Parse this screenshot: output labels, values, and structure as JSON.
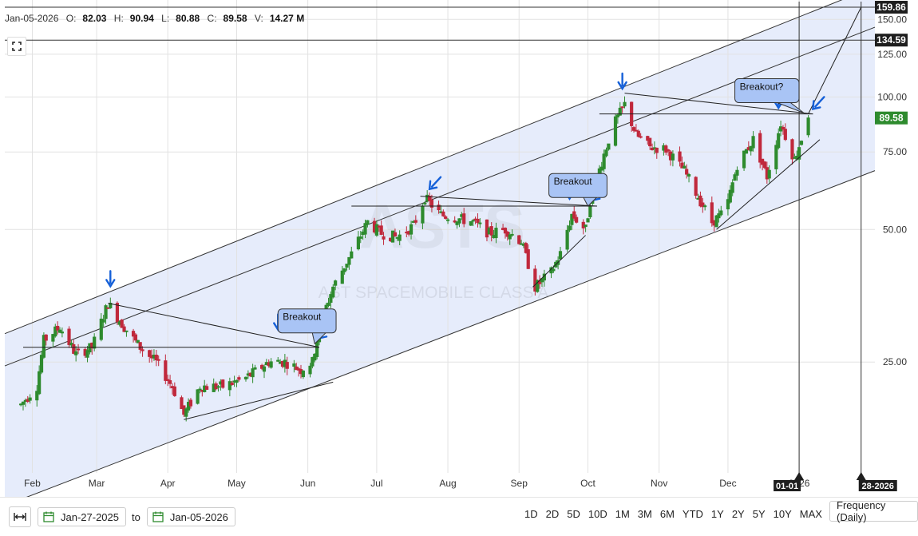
{
  "header": {
    "date": "Jan-05-2026",
    "open_label": "O:",
    "open": "82.03",
    "high_label": "H:",
    "high": "90.94",
    "low_label": "L:",
    "low": "80.88",
    "close_label": "C:",
    "close": "89.58",
    "volume_label": "V:",
    "volume": "14.27 M"
  },
  "watermark": {
    "symbol": "ASTS",
    "name": "AST SPACEMOBILE CLASS A"
  },
  "colors": {
    "up": "#2e8b2e",
    "down": "#c0283c",
    "channel_fill": "#e6ecfb",
    "callout_fill": "#a9c4f5",
    "arrow": "#1560d8",
    "last_price": "#2e8b2e"
  },
  "chart_data": {
    "type": "candlestick",
    "y_scale": "log",
    "ylim": [
      14,
      166
    ],
    "x_range": [
      "2025-01-20",
      "2026-02-03"
    ],
    "grid": true,
    "y_ticks": [
      {
        "value": 150,
        "label": "150.00"
      },
      {
        "value": 125,
        "label": "125.00"
      },
      {
        "value": 100,
        "label": "100.00"
      },
      {
        "value": 75,
        "label": "75.00"
      },
      {
        "value": 50,
        "label": "50.00"
      },
      {
        "value": 25,
        "label": "25.00"
      }
    ],
    "x_ticks": [
      {
        "date": "2025-02-01",
        "label": "Feb"
      },
      {
        "date": "2025-03-01",
        "label": "Mar"
      },
      {
        "date": "2025-04-01",
        "label": "Apr"
      },
      {
        "date": "2025-05-01",
        "label": "May"
      },
      {
        "date": "2025-06-01",
        "label": "Jun"
      },
      {
        "date": "2025-07-01",
        "label": "Jul"
      },
      {
        "date": "2025-08-01",
        "label": "Aug"
      },
      {
        "date": "2025-09-01",
        "label": "Sep"
      },
      {
        "date": "2025-10-01",
        "label": "Oct"
      },
      {
        "date": "2025-11-01",
        "label": "Nov"
      },
      {
        "date": "2025-12-01",
        "label": "Dec"
      },
      {
        "date": "2026-01-01",
        "label": "2026"
      }
    ],
    "price_flags": [
      {
        "value": 159.86,
        "label": "159.86",
        "style": "dark"
      },
      {
        "value": 134.59,
        "label": "134.59",
        "style": "dark"
      },
      {
        "value": 89.58,
        "label": "89.58",
        "style": "last"
      }
    ],
    "date_flags": [
      {
        "date": "2026-01-01",
        "label": "01-01"
      },
      {
        "date": "2026-01-28",
        "label": "28-2026"
      }
    ],
    "price_keypoints": [
      [
        "2025-01-27",
        20
      ],
      [
        "2025-02-03",
        22
      ],
      [
        "2025-02-06",
        28
      ],
      [
        "2025-02-13",
        30
      ],
      [
        "2025-02-20",
        26
      ],
      [
        "2025-02-27",
        27
      ],
      [
        "2025-03-06",
        34
      ],
      [
        "2025-03-13",
        30
      ],
      [
        "2025-03-20",
        27
      ],
      [
        "2025-03-27",
        25
      ],
      [
        "2025-04-03",
        22
      ],
      [
        "2025-04-08",
        19
      ],
      [
        "2025-04-15",
        22
      ],
      [
        "2025-04-25",
        22
      ],
      [
        "2025-05-05",
        23
      ],
      [
        "2025-05-15",
        25
      ],
      [
        "2025-05-22",
        25
      ],
      [
        "2025-05-29",
        24
      ],
      [
        "2025-06-03",
        25
      ],
      [
        "2025-06-06",
        30
      ],
      [
        "2025-06-12",
        37
      ],
      [
        "2025-06-20",
        44
      ],
      [
        "2025-06-27",
        52
      ],
      [
        "2025-07-03",
        49
      ],
      [
        "2025-07-10",
        48
      ],
      [
        "2025-07-17",
        51
      ],
      [
        "2025-07-22",
        59
      ],
      [
        "2025-07-29",
        54
      ],
      [
        "2025-08-05",
        53
      ],
      [
        "2025-08-12",
        52
      ],
      [
        "2025-08-19",
        49
      ],
      [
        "2025-08-26",
        50
      ],
      [
        "2025-09-02",
        47
      ],
      [
        "2025-09-08",
        37
      ],
      [
        "2025-09-15",
        40
      ],
      [
        "2025-09-19",
        44
      ],
      [
        "2025-09-24",
        54
      ],
      [
        "2025-09-30",
        50
      ],
      [
        "2025-10-02",
        58
      ],
      [
        "2025-10-08",
        74
      ],
      [
        "2025-10-12",
        86
      ],
      [
        "2025-10-17",
        96
      ],
      [
        "2025-10-22",
        82
      ],
      [
        "2025-10-28",
        77
      ],
      [
        "2025-11-04",
        76
      ],
      [
        "2025-11-12",
        68
      ],
      [
        "2025-11-19",
        58
      ],
      [
        "2025-11-24",
        52
      ],
      [
        "2025-11-30",
        55
      ],
      [
        "2025-12-05",
        70
      ],
      [
        "2025-12-12",
        80
      ],
      [
        "2025-12-18",
        66
      ],
      [
        "2025-12-24",
        87
      ],
      [
        "2025-12-30",
        72
      ],
      [
        "2026-01-05",
        89.58
      ]
    ],
    "annotations": [
      {
        "type": "callout",
        "text": "Breakout",
        "box": [
          "2025-05-19",
          33
        ],
        "tip": [
          "2025-06-04",
          27.5
        ]
      },
      {
        "type": "callout",
        "text": "Breakout",
        "box": [
          "2025-09-14",
          67
        ],
        "tip": [
          "2025-10-01",
          56.5
        ]
      },
      {
        "type": "callout",
        "text": "Breakout?",
        "box": [
          "2025-12-04",
          110
        ],
        "tip": [
          "2026-01-03",
          92
        ]
      }
    ]
  },
  "bottom": {
    "from_date": "Jan-27-2025",
    "to_label": "to",
    "to_date": "Jan-05-2026",
    "periods": [
      "1D",
      "2D",
      "5D",
      "10D",
      "1M",
      "3M",
      "6M",
      "YTD",
      "1Y",
      "2Y",
      "5Y",
      "10Y",
      "MAX"
    ],
    "frequency": "Frequency (Daily)"
  }
}
